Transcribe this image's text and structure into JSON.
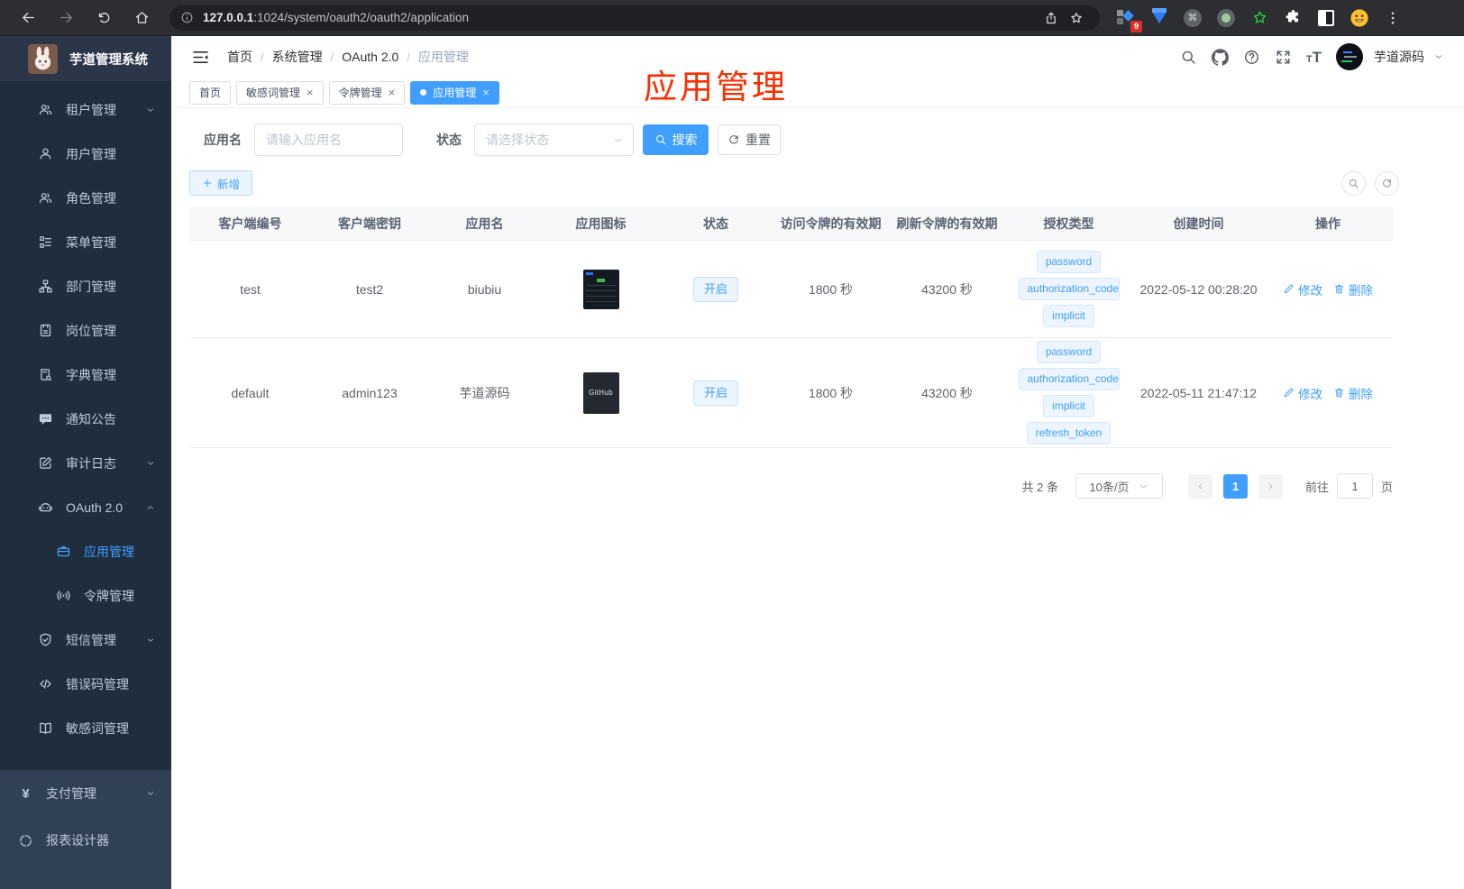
{
  "browser": {
    "url_host": "127.0.0.1",
    "url_path": ":1024/system/oauth2/oauth2/application",
    "extension_badge": "9"
  },
  "app": {
    "logo_title": "芋道管理系统",
    "username": "芋道源码"
  },
  "sidebar": {
    "items": [
      {
        "label": "租户管理"
      },
      {
        "label": "用户管理"
      },
      {
        "label": "角色管理"
      },
      {
        "label": "菜单管理"
      },
      {
        "label": "部门管理"
      },
      {
        "label": "岗位管理"
      },
      {
        "label": "字典管理"
      },
      {
        "label": "通知公告"
      },
      {
        "label": "审计日志"
      },
      {
        "label": "OAuth 2.0"
      },
      {
        "label": "应用管理"
      },
      {
        "label": "令牌管理"
      },
      {
        "label": "短信管理"
      },
      {
        "label": "错误码管理"
      },
      {
        "label": "敏感词管理"
      },
      {
        "label": "支付管理"
      },
      {
        "label": "报表设计器"
      }
    ]
  },
  "breadcrumb": [
    "首页",
    "系统管理",
    "OAuth 2.0",
    "应用管理"
  ],
  "tabs": [
    {
      "label": "首页"
    },
    {
      "label": "敏感词管理"
    },
    {
      "label": "令牌管理"
    },
    {
      "label": "应用管理"
    }
  ],
  "annotation": {
    "text": "应用管理",
    "color": "#ff2d00"
  },
  "filters": {
    "name_label": "应用名",
    "name_placeholder": "请输入应用名",
    "status_label": "状态",
    "status_placeholder": "请选择状态",
    "search_label": "搜索",
    "reset_label": "重置"
  },
  "toolbar": {
    "add_label": "新增"
  },
  "table": {
    "columns": [
      "客户端编号",
      "客户端密钥",
      "应用名",
      "应用图标",
      "状态",
      "访问令牌的有效期",
      "刷新令牌的有效期",
      "授权类型",
      "创建时间",
      "操作"
    ],
    "edit_label": "修改",
    "delete_label": "删除",
    "rows": [
      {
        "client_id": "test",
        "secret": "test2",
        "name": "biubiu",
        "status": "开启",
        "access_ttl": "1800 秒",
        "refresh_ttl": "43200 秒",
        "grant_types": [
          "password",
          "authorization_code",
          "implicit"
        ],
        "created": "2022-05-12 00:28:20"
      },
      {
        "client_id": "default",
        "secret": "admin123",
        "name": "芋道源码",
        "icon_text": "GitHub",
        "status": "开启",
        "access_ttl": "1800 秒",
        "refresh_ttl": "43200 秒",
        "grant_types": [
          "password",
          "authorization_code",
          "implicit",
          "refresh_token"
        ],
        "created": "2022-05-11 21:47:12"
      }
    ]
  },
  "pagination": {
    "total": "共 2 条",
    "page_size": "10条/页",
    "page": "1",
    "goto_label": "前往",
    "goto_value": "1",
    "goto_suffix": "页"
  },
  "colors": {
    "accent": "#409eff",
    "sidebar_bg": "#304156",
    "submenu_bg": "#1f2d3d"
  }
}
